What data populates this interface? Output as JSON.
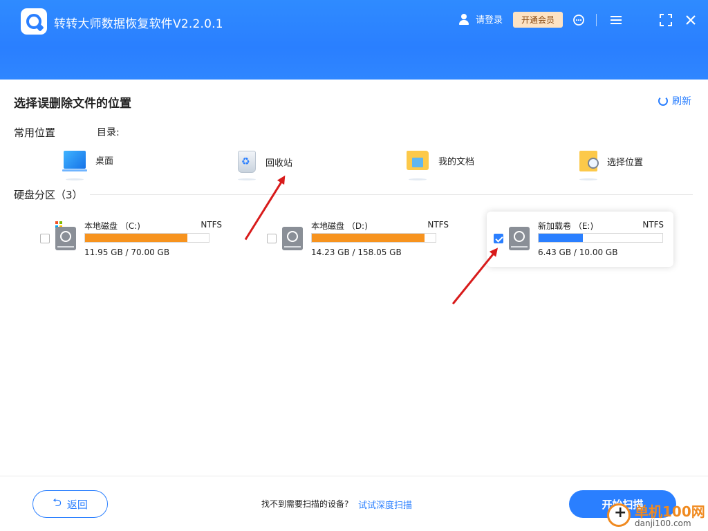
{
  "header": {
    "title": "转转大师数据恢复软件V2.2.0.1",
    "login_label": "请登录",
    "vip_label": "开通会员",
    "icons": [
      "user-icon",
      "support-icon",
      "menu-icon",
      "fullscreen-icon",
      "close-icon"
    ]
  },
  "page": {
    "title": "选择误删除文件的位置",
    "refresh_label": "刷新"
  },
  "common": {
    "label": "常用位置",
    "dir_label": "目录:",
    "items": [
      {
        "label": "桌面",
        "icon": "desktop-icon"
      },
      {
        "label": "回收站",
        "icon": "recycle-bin-icon"
      },
      {
        "label": "我的文档",
        "icon": "documents-folder-icon"
      },
      {
        "label": "选择位置",
        "icon": "select-location-icon"
      }
    ]
  },
  "disks": {
    "label": "硬盘分区",
    "count": "（3）",
    "items": [
      {
        "name": "本地磁盘 （C:)",
        "fs": "NTFS",
        "size": "11.95 GB / 70.00 GB",
        "used_fraction": 0.829,
        "bar_color": "#f7931e",
        "checked": false
      },
      {
        "name": "本地磁盘 （D:)",
        "fs": "NTFS",
        "size": "14.23 GB / 158.05 GB",
        "used_fraction": 0.91,
        "bar_color": "#f7931e",
        "checked": false
      },
      {
        "name": "新加载卷 （E:)",
        "fs": "NTFS",
        "size": "6.43 GB / 10.00 GB",
        "used_fraction": 0.357,
        "bar_color": "#2a7fff",
        "checked": true
      }
    ]
  },
  "footer": {
    "back_label": "返回",
    "no_device_text": "找不到需要扫描的设备?",
    "deep_scan_label": "试试深度扫描",
    "scan_label": "开始扫描"
  },
  "watermark": {
    "text1": "单机100网",
    "text2": "danji100.com"
  },
  "colors": {
    "accent": "#2a7fff",
    "disk_bar_orange": "#f7931e",
    "arrow": "#d81b1b"
  }
}
